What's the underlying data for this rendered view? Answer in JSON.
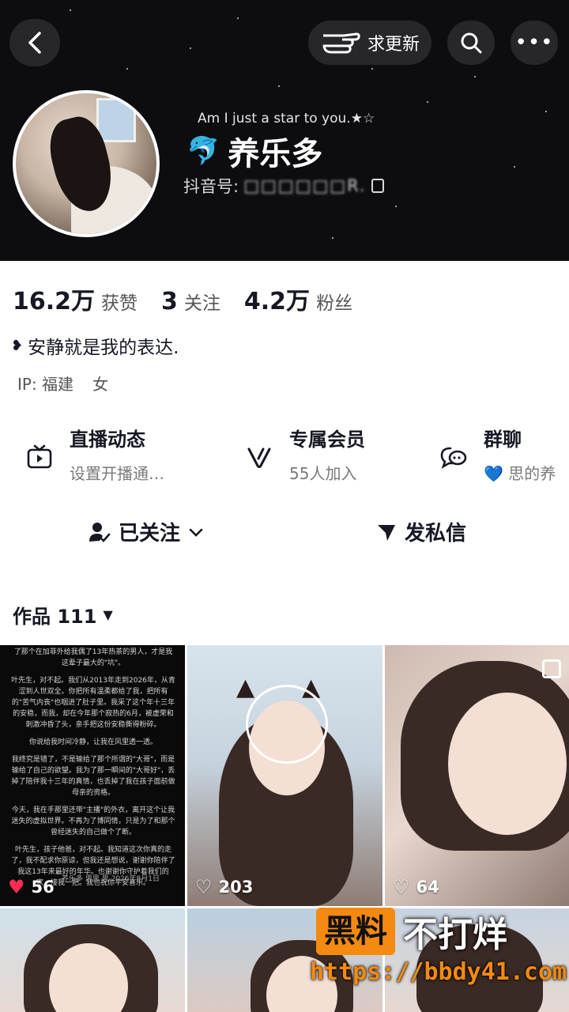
{
  "header": {
    "update_label": "求更新",
    "slogan": "Am I just a star to you.★☆",
    "nickname": "养乐多",
    "douyin_prefix": "抖音号:",
    "douyin_id": "□□□□□□R."
  },
  "stats": [
    {
      "num": "16.2万",
      "label": "获赞"
    },
    {
      "num": "3",
      "label": "关注"
    },
    {
      "num": "4.2万",
      "label": "粉丝"
    }
  ],
  "bio": "安静就是我的表达.",
  "ip": {
    "label": "IP: 福建",
    "gender": "女"
  },
  "features": [
    {
      "title": "直播动态",
      "subtitle": "设置开播通…"
    },
    {
      "title": "专属会员",
      "subtitle": "55人加入"
    },
    {
      "title": "群聊",
      "subtitle": "思的养"
    }
  ],
  "actions": {
    "follow": "已关注",
    "message": "发私信"
  },
  "works": {
    "label": "作品 111"
  },
  "grid": {
    "text_post": [
      "了那个在加菲外给我偶了13年热茶的男人，才是我这辈子最大的\"坑\"。",
      "叶先生，对不起。我们从2013年走到2026年，从青涩到人世双全。你把所有温柔都给了我，把所有的\"苦气内丧\"也咽进了肚子里。我采了这个年十三年的安稳，而我，却在今年那个寂热的6月，被虚荣和刺激冲昏了头，亲手把这份安稳撕得粉碎。",
      "你说给我时间冷静，让我在风里透一透。",
      "我终究是错了，不是输给了那个所谓的\"大哥\"，而是输给了自己的欲望。我为了那一瞬间的\"大哥好\"，丢掉了陪伴我十三年的真情，也丢掉了我在孩子面前做母亲的资格。",
      "今天，我在手那里还带\"主播\"的外衣，离开这个让我迷失的虚拟世界。不再为了博同情，只是为了和那个曾经迷失的自己做个了断。",
      "叶先生，孩子他爸，对不起。我知道这次你真的走了，我不配求你原谅，但我还是想说，谢谢你陪伴了我这13年来最好的年华。也谢谢你守护着我们的家，接我一把。我也祝你平安喜乐。"
    ],
    "text_post_footer": "养乐多 思思 思 2026年8月1日",
    "likes": [
      "56",
      "203",
      "64"
    ]
  },
  "watermark": {
    "box": "黑料",
    "text": "不打烊",
    "url": "https://bbdy41.com"
  }
}
